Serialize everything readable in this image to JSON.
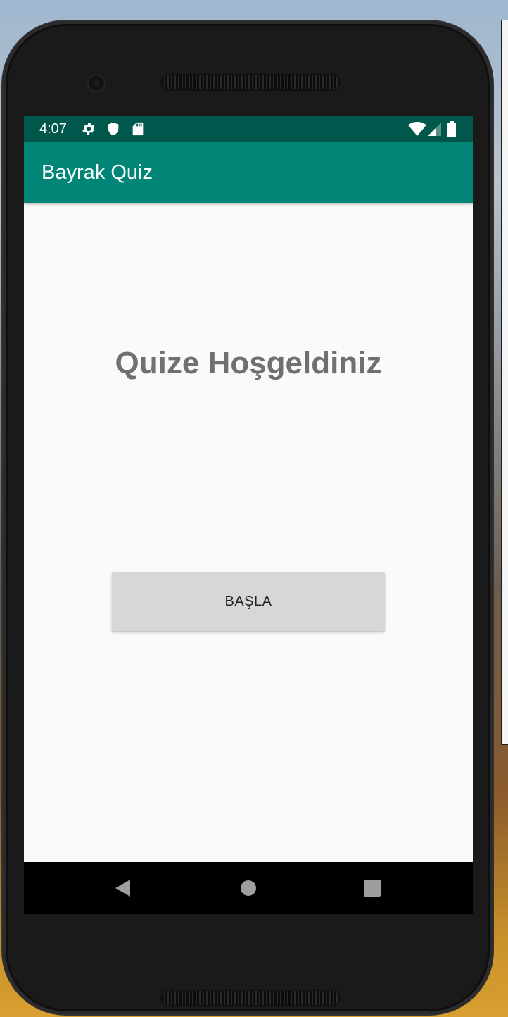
{
  "status_bar": {
    "time": "4:07",
    "icons": [
      "gear-icon",
      "shield-icon",
      "sd-card-icon",
      "wifi-icon",
      "signal-icon",
      "battery-icon"
    ]
  },
  "app_bar": {
    "title": "Bayrak Quiz"
  },
  "main": {
    "welcome_text": "Quize Hoşgeldiniz",
    "start_button_label": "BAŞLA"
  },
  "nav_bar": {
    "buttons": [
      "back-icon",
      "home-icon",
      "recents-icon"
    ]
  },
  "colors": {
    "status_bar": "#00574b",
    "app_bar": "#008577",
    "background": "#fafafa",
    "button": "#d6d7d7",
    "welcome_text": "#707070"
  }
}
